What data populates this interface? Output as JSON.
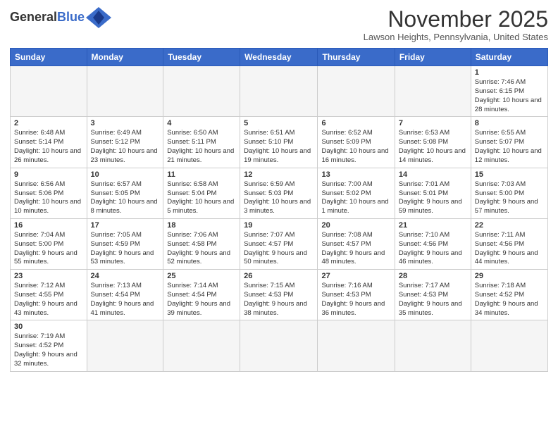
{
  "header": {
    "logo_general": "General",
    "logo_blue": "Blue",
    "month_title": "November 2025",
    "location": "Lawson Heights, Pennsylvania, United States"
  },
  "weekdays": [
    "Sunday",
    "Monday",
    "Tuesday",
    "Wednesday",
    "Thursday",
    "Friday",
    "Saturday"
  ],
  "weeks": [
    [
      {
        "day": "",
        "info": ""
      },
      {
        "day": "",
        "info": ""
      },
      {
        "day": "",
        "info": ""
      },
      {
        "day": "",
        "info": ""
      },
      {
        "day": "",
        "info": ""
      },
      {
        "day": "",
        "info": ""
      },
      {
        "day": "1",
        "info": "Sunrise: 7:46 AM\nSunset: 6:15 PM\nDaylight: 10 hours\nand 28 minutes."
      }
    ],
    [
      {
        "day": "2",
        "info": "Sunrise: 6:48 AM\nSunset: 5:14 PM\nDaylight: 10 hours\nand 26 minutes."
      },
      {
        "day": "3",
        "info": "Sunrise: 6:49 AM\nSunset: 5:12 PM\nDaylight: 10 hours\nand 23 minutes."
      },
      {
        "day": "4",
        "info": "Sunrise: 6:50 AM\nSunset: 5:11 PM\nDaylight: 10 hours\nand 21 minutes."
      },
      {
        "day": "5",
        "info": "Sunrise: 6:51 AM\nSunset: 5:10 PM\nDaylight: 10 hours\nand 19 minutes."
      },
      {
        "day": "6",
        "info": "Sunrise: 6:52 AM\nSunset: 5:09 PM\nDaylight: 10 hours\nand 16 minutes."
      },
      {
        "day": "7",
        "info": "Sunrise: 6:53 AM\nSunset: 5:08 PM\nDaylight: 10 hours\nand 14 minutes."
      },
      {
        "day": "8",
        "info": "Sunrise: 6:55 AM\nSunset: 5:07 PM\nDaylight: 10 hours\nand 12 minutes."
      }
    ],
    [
      {
        "day": "9",
        "info": "Sunrise: 6:56 AM\nSunset: 5:06 PM\nDaylight: 10 hours\nand 10 minutes."
      },
      {
        "day": "10",
        "info": "Sunrise: 6:57 AM\nSunset: 5:05 PM\nDaylight: 10 hours\nand 8 minutes."
      },
      {
        "day": "11",
        "info": "Sunrise: 6:58 AM\nSunset: 5:04 PM\nDaylight: 10 hours\nand 5 minutes."
      },
      {
        "day": "12",
        "info": "Sunrise: 6:59 AM\nSunset: 5:03 PM\nDaylight: 10 hours\nand 3 minutes."
      },
      {
        "day": "13",
        "info": "Sunrise: 7:00 AM\nSunset: 5:02 PM\nDaylight: 10 hours\nand 1 minute."
      },
      {
        "day": "14",
        "info": "Sunrise: 7:01 AM\nSunset: 5:01 PM\nDaylight: 9 hours\nand 59 minutes."
      },
      {
        "day": "15",
        "info": "Sunrise: 7:03 AM\nSunset: 5:00 PM\nDaylight: 9 hours\nand 57 minutes."
      }
    ],
    [
      {
        "day": "16",
        "info": "Sunrise: 7:04 AM\nSunset: 5:00 PM\nDaylight: 9 hours\nand 55 minutes."
      },
      {
        "day": "17",
        "info": "Sunrise: 7:05 AM\nSunset: 4:59 PM\nDaylight: 9 hours\nand 53 minutes."
      },
      {
        "day": "18",
        "info": "Sunrise: 7:06 AM\nSunset: 4:58 PM\nDaylight: 9 hours\nand 52 minutes."
      },
      {
        "day": "19",
        "info": "Sunrise: 7:07 AM\nSunset: 4:57 PM\nDaylight: 9 hours\nand 50 minutes."
      },
      {
        "day": "20",
        "info": "Sunrise: 7:08 AM\nSunset: 4:57 PM\nDaylight: 9 hours\nand 48 minutes."
      },
      {
        "day": "21",
        "info": "Sunrise: 7:10 AM\nSunset: 4:56 PM\nDaylight: 9 hours\nand 46 minutes."
      },
      {
        "day": "22",
        "info": "Sunrise: 7:11 AM\nSunset: 4:56 PM\nDaylight: 9 hours\nand 44 minutes."
      }
    ],
    [
      {
        "day": "23",
        "info": "Sunrise: 7:12 AM\nSunset: 4:55 PM\nDaylight: 9 hours\nand 43 minutes."
      },
      {
        "day": "24",
        "info": "Sunrise: 7:13 AM\nSunset: 4:54 PM\nDaylight: 9 hours\nand 41 minutes."
      },
      {
        "day": "25",
        "info": "Sunrise: 7:14 AM\nSunset: 4:54 PM\nDaylight: 9 hours\nand 39 minutes."
      },
      {
        "day": "26",
        "info": "Sunrise: 7:15 AM\nSunset: 4:53 PM\nDaylight: 9 hours\nand 38 minutes."
      },
      {
        "day": "27",
        "info": "Sunrise: 7:16 AM\nSunset: 4:53 PM\nDaylight: 9 hours\nand 36 minutes."
      },
      {
        "day": "28",
        "info": "Sunrise: 7:17 AM\nSunset: 4:53 PM\nDaylight: 9 hours\nand 35 minutes."
      },
      {
        "day": "29",
        "info": "Sunrise: 7:18 AM\nSunset: 4:52 PM\nDaylight: 9 hours\nand 34 minutes."
      }
    ],
    [
      {
        "day": "30",
        "info": "Sunrise: 7:19 AM\nSunset: 4:52 PM\nDaylight: 9 hours\nand 32 minutes."
      },
      {
        "day": "",
        "info": ""
      },
      {
        "day": "",
        "info": ""
      },
      {
        "day": "",
        "info": ""
      },
      {
        "day": "",
        "info": ""
      },
      {
        "day": "",
        "info": ""
      },
      {
        "day": "",
        "info": ""
      }
    ]
  ]
}
